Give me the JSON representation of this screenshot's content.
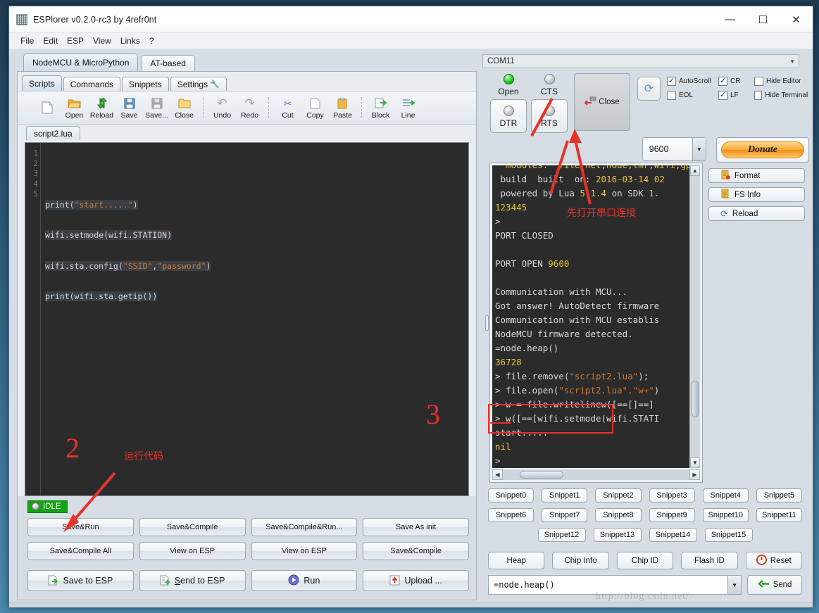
{
  "window": {
    "title": "ESPlorer v0.2.0-rc3 by 4refr0nt",
    "icon": "app-icon",
    "minimize": "—",
    "maximize": "☐",
    "close": "✕"
  },
  "menubar": [
    "File",
    "Edit",
    "ESP",
    "View",
    "Links",
    "?"
  ],
  "top_tabs": [
    {
      "label": "NodeMCU & MicroPython",
      "selected": true
    },
    {
      "label": "AT-based",
      "selected": false
    }
  ],
  "sub_tabs": [
    {
      "label": "Scripts",
      "selected": true
    },
    {
      "label": "Commands",
      "selected": false
    },
    {
      "label": "Snippets",
      "selected": false
    },
    {
      "label": "Settings",
      "selected": false,
      "icon": "wrench-icon"
    }
  ],
  "toolbar": [
    {
      "label": "",
      "icon": "new-file-icon",
      "glyph": "⬜"
    },
    {
      "label": "Open",
      "icon": "open-folder-icon",
      "glyph": "📂"
    },
    {
      "label": "Reload",
      "icon": "reload-icon",
      "glyph": "⇅"
    },
    {
      "label": "Save",
      "icon": "save-disk-icon",
      "glyph": "💾"
    },
    {
      "label": "Save...",
      "icon": "save-as-icon",
      "glyph": "🖫"
    },
    {
      "label": "Close",
      "icon": "close-folder-icon",
      "glyph": "📁"
    },
    {
      "label": "Undo",
      "icon": "undo-icon",
      "glyph": "↶"
    },
    {
      "label": "Redo",
      "icon": "redo-icon",
      "glyph": "↷"
    },
    {
      "label": "Cut",
      "icon": "scissors-icon",
      "glyph": "✂"
    },
    {
      "label": "Copy",
      "icon": "copy-icon",
      "glyph": "❐"
    },
    {
      "label": "Paste",
      "icon": "clipboard-icon",
      "glyph": "📋"
    },
    {
      "label": "Block",
      "icon": "send-block-icon",
      "glyph": "➡"
    },
    {
      "label": "Line",
      "icon": "send-line-icon",
      "glyph": "➡"
    }
  ],
  "file_tab": "script2.lua",
  "editor": {
    "line_numbers": [
      "1",
      "2",
      "3",
      "4",
      "5"
    ],
    "lines": [
      "",
      "print(\"start.....\")",
      "wifi.setmode(wifi.STATION)",
      "wifi.sta.config(\"SSID\",\"password\")",
      "print(wifi.sta.getip())"
    ]
  },
  "status": {
    "label": "IDLE"
  },
  "action_buttons": {
    "row1": [
      "Save&Run",
      "Save&Compile",
      "Save&Compile&Run...",
      "Save As init"
    ],
    "row2": [
      "Save&Compile All",
      "View on ESP",
      "View on ESP",
      "Save&Compile"
    ],
    "row3": [
      {
        "label": "Save to ESP",
        "icon": "save-to-esp-icon",
        "glyph": "🖫"
      },
      {
        "label": "Send to ESP",
        "icon": "send-to-esp-icon",
        "glyph": "🗎"
      },
      {
        "label": "Run",
        "icon": "run-icon",
        "glyph": "▶"
      },
      {
        "label": "Upload ...",
        "icon": "upload-icon",
        "glyph": "⬆"
      }
    ]
  },
  "connection": {
    "port": "COM11",
    "leds": [
      {
        "label": "Open",
        "state": "on"
      },
      {
        "label": "CTS",
        "state": "off"
      }
    ],
    "sq_buttons": [
      {
        "label": "DTR",
        "state": "off"
      },
      {
        "label": "RTS",
        "state": "off"
      }
    ],
    "close_button": {
      "label": "Close",
      "icon": "disconnect-icon"
    },
    "refresh_button": {
      "icon": "refresh-icon",
      "glyph": "⟳"
    },
    "baud": "9600",
    "donate": "Donate",
    "checkboxes": [
      {
        "label": "AutoScroll",
        "checked": true
      },
      {
        "label": "CR",
        "checked": true
      },
      {
        "label": "Hide Editor",
        "checked": false
      },
      {
        "label": "EOL",
        "checked": false
      },
      {
        "label": "LF",
        "checked": true
      },
      {
        "label": "Hide Terminal",
        "checked": false
      }
    ]
  },
  "terminal": {
    "lines": [
      {
        "segments": [
          {
            "t": "  modules:  file,net,node,tmr,wifi,gpio,pwm",
            "c": "y"
          }
        ]
      },
      {
        "segments": [
          {
            "t": " build  built  on: ",
            "c": "w"
          },
          {
            "t": "2016-03-14 02",
            "c": "y"
          }
        ]
      },
      {
        "segments": [
          {
            "t": " powered by L",
            "c": "w"
          },
          {
            "t": "ua ",
            "c": "w"
          },
          {
            "t": "5.1.4",
            "c": "y"
          },
          {
            "t": " on SDK ",
            "c": "w"
          },
          {
            "t": "1.",
            "c": "y"
          }
        ]
      },
      {
        "segments": [
          {
            "t": "123445",
            "c": "y"
          }
        ]
      },
      {
        "segments": [
          {
            "t": ">",
            "c": "w"
          }
        ]
      },
      {
        "segments": [
          {
            "t": "PORT CLOSED",
            "c": "w"
          }
        ]
      },
      {
        "segments": [
          {
            "t": "",
            "c": "w"
          }
        ]
      },
      {
        "segments": [
          {
            "t": "PORT OPEN ",
            "c": "w"
          },
          {
            "t": "9600",
            "c": "y"
          }
        ]
      },
      {
        "segments": [
          {
            "t": "",
            "c": "w"
          }
        ]
      },
      {
        "segments": [
          {
            "t": "Communication with MCU...",
            "c": "w"
          }
        ]
      },
      {
        "segments": [
          {
            "t": "Got answer! AutoDetect firmware",
            "c": "w"
          }
        ]
      },
      {
        "segments": [
          {
            "t": "Communication with MCU establis",
            "c": "w"
          }
        ]
      },
      {
        "segments": [
          {
            "t": "NodeMCU firmware detected.",
            "c": "w"
          }
        ]
      },
      {
        "segments": [
          {
            "t": "=node.heap()",
            "c": "w"
          }
        ]
      },
      {
        "segments": [
          {
            "t": "36728",
            "c": "y"
          }
        ]
      },
      {
        "segments": [
          {
            "t": "> file.remove(",
            "c": "w"
          },
          {
            "t": "\"script2.lua\"",
            "c": "o"
          },
          {
            "t": ");",
            "c": "w"
          }
        ]
      },
      {
        "segments": [
          {
            "t": "> file.open(",
            "c": "w"
          },
          {
            "t": "\"script2.lua\",\"w+\"",
            "c": "o"
          },
          {
            "t": ")",
            "c": "w"
          }
        ]
      },
      {
        "segments": [
          {
            "t": "> w = file.writelinew([==[]==]",
            "c": "w"
          }
        ]
      },
      {
        "segments": [
          {
            "t": "> w([==[wifi.setmode(wifi.STATI",
            "c": "w"
          }
        ]
      },
      {
        "segments": [
          {
            "t": "start.....",
            "c": "w"
          }
        ]
      },
      {
        "segments": [
          {
            "t": "nil",
            "c": "y"
          }
        ]
      },
      {
        "segments": [
          {
            "t": ">",
            "c": "w"
          }
        ]
      }
    ]
  },
  "side_buttons": [
    {
      "label": "Format",
      "icon": "format-icon",
      "glyph": "🗎"
    },
    {
      "label": "FS Info",
      "icon": "fs-info-icon",
      "glyph": "🗊"
    },
    {
      "label": "Reload",
      "icon": "reload-icon",
      "glyph": "⟳"
    }
  ],
  "snippets": {
    "row1": [
      "Snippet0",
      "Snippet1",
      "Snippet2",
      "Snippet3",
      "Snippet4",
      "Snippet5"
    ],
    "row2": [
      "Snippet6",
      "Snippet7",
      "Snippet8",
      "Snippet9",
      "Snippet10",
      "Snippet11"
    ],
    "row3": [
      "Snippet12",
      "Snippet13",
      "Snippet14",
      "Snippet15"
    ]
  },
  "info_buttons": [
    {
      "label": "Heap",
      "icon": ""
    },
    {
      "label": "Chip Info",
      "icon": ""
    },
    {
      "label": "Chip ID",
      "icon": ""
    },
    {
      "label": "Flash ID",
      "icon": ""
    },
    {
      "label": "Reset",
      "icon": "power-icon",
      "glyph": "⏻"
    }
  ],
  "command_bar": {
    "value": "=node.heap()",
    "placeholder": "",
    "send_label": "Send",
    "send_icon": "arrow-left-icon"
  },
  "annotations": {
    "mark_1_text": "先打开串口连接",
    "mark_2_number": "2",
    "mark_2_text": "运行代码",
    "mark_3_number": "3",
    "color": "#e8322a"
  },
  "watermark": "http://blog.csdn.net/"
}
